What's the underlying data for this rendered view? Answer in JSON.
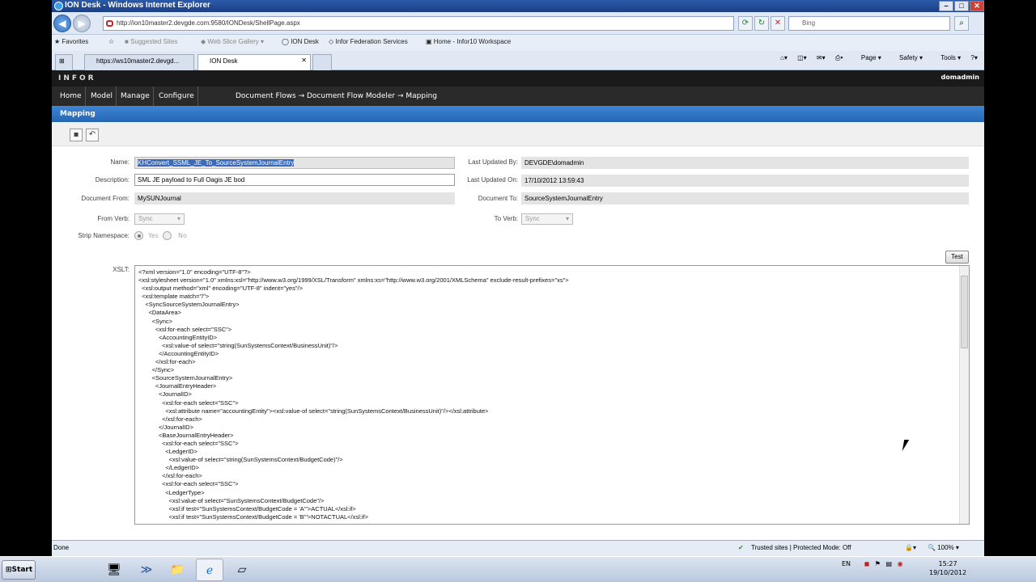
{
  "window": {
    "title": "ION Desk - Windows Internet Explorer",
    "url": "http://ion10master2.devgde.com:9580/IONDesk/ShellPage.aspx",
    "search_placeholder": "Bing"
  },
  "favorites": {
    "label": "Favorites",
    "items": [
      "Suggested Sites",
      "Web Slice Gallery",
      "ION Desk",
      "Infor Federation Services",
      "Home - Infor10 Workspace"
    ]
  },
  "tabs": [
    {
      "label": "https://ws10master2.devgd...",
      "active": false
    },
    {
      "label": "ION Desk",
      "active": true
    }
  ],
  "command_bar": {
    "page": "Page",
    "safety": "Safety",
    "tools": "Tools"
  },
  "app": {
    "logo": "INFOR",
    "user": "domadmin",
    "menu": [
      "Home",
      "Model",
      "Manage",
      "Configure"
    ],
    "breadcrumb": "Document Flows → Document Flow Modeler → Mapping",
    "section_title": "Mapping"
  },
  "form": {
    "name_label": "Name:",
    "name_value": "KHConvert_SSML_JE_To_SourceSystemJournalEntry",
    "description_label": "Description:",
    "description_value": "SML JE payload to Full Oagis JE bod",
    "document_from_label": "Document From:",
    "document_from_value": "MySUNJournal",
    "from_verb_label": "From Verb:",
    "from_verb_value": "Sync",
    "strip_namespace_label": "Strip Namespace:",
    "strip_yes": "Yes",
    "strip_no": "No",
    "last_updated_by_label": "Last Updated By:",
    "last_updated_by_value": "DEVGDE\\domadmin",
    "last_updated_on_label": "Last Updated On:",
    "last_updated_on_value": "17/10/2012 13:59:43",
    "document_to_label": "Document To:",
    "document_to_value": "SourceSystemJournalEntry",
    "to_verb_label": "To Verb:",
    "to_verb_value": "Sync",
    "xslt_label": "XSLT:",
    "test_button": "Test",
    "xslt_lines": [
      "<?xml version=\"1.0\" encoding=\"UTF-8\"?>",
      "<xsl:stylesheet version=\"1.0\" xmlns:xsl=\"http://www.w3.org/1999/XSL/Transform\" xmlns:xs=\"http://www.w3.org/2001/XMLSchema\" exclude-result-prefixes=\"xs\">",
      "  <xsl:output method=\"xml\" encoding=\"UTF-8\" indent=\"yes\"/>",
      "  <xsl:template match=\"/\">",
      "    <SyncSourceSystemJournalEntry>",
      "      <DataArea>",
      "        <Sync>",
      "          <xsl:for-each select=\"SSC\">",
      "            <AccountingEntityID>",
      "              <xsl:value-of select=\"string(SunSystemsContext/BusinessUnit)\"/>",
      "            </AccountingEntityID>",
      "          </xsl:for-each>",
      "        </Sync>",
      "        <SourceSystemJournalEntry>",
      "          <JournalEntryHeader>",
      "            <JournalID>",
      "              <xsl:for-each select=\"SSC\">",
      "                <xsl:attribute name=\"accountingEntity\"><xsl:value-of select=\"string(SunSystemsContext/BusinessUnit)\"/></xsl:attribute>",
      "              </xsl:for-each>",
      "            </JournalID>",
      "            <BaseJournalEntryHeader>",
      "              <xsl:for-each select=\"SSC\">",
      "                <LedgerID>",
      "                  <xsl:value-of select=\"string(SunSystemsContext/BudgetCode)\"/>",
      "                </LedgerID>",
      "              </xsl:for-each>",
      "              <xsl:for-each select=\"SSC\">",
      "                <LedgerType>",
      "                  <xsl:value-of select=\"SunSystemsContext/BudgetCode\"/>",
      "                  <xsl:if test=\"SunSystemsContext/BudgetCode = 'A'\">ACTUAL</xsl:if>",
      "                  <xsl:if test=\"SunSystemsContext/BudgetCode = 'B'\">NOTACTUAL</xsl:if>"
    ]
  },
  "status": {
    "left": "Done",
    "zone": "Trusted sites | Protected Mode: Off",
    "zoom": "100%"
  },
  "taskbar": {
    "start": "Start",
    "lang": "EN",
    "time": "15:27",
    "date": "19/10/2012"
  }
}
